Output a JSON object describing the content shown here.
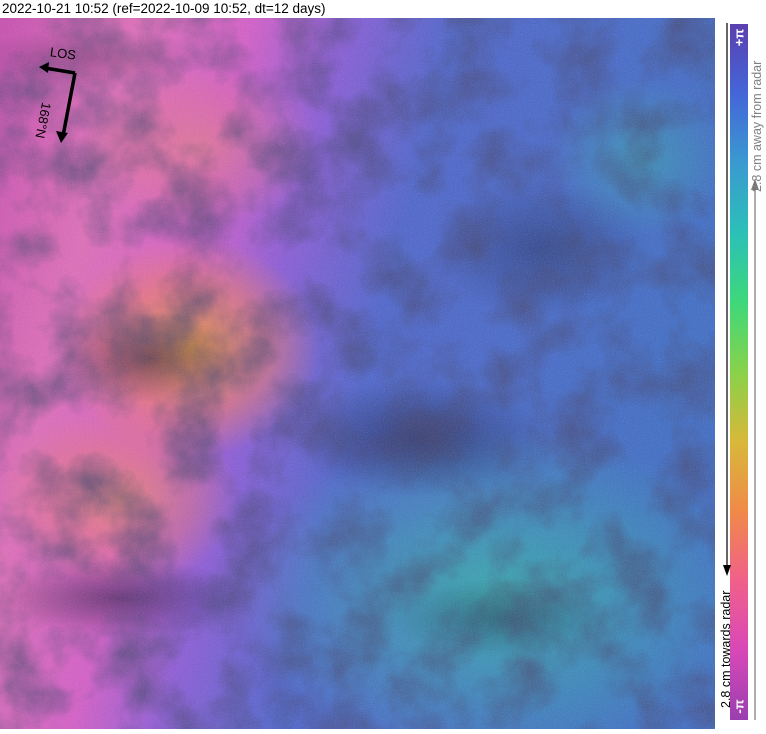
{
  "title": "2022-10-21 10:52 (ref=2022-10-09 10:52, dt=12 days)",
  "compass": {
    "los_label": "LOS",
    "heading_label": "168°N"
  },
  "colorbar": {
    "top_label": "+π",
    "bottom_label": "-π",
    "away_label": "2.8 cm away from radar",
    "towards_label": "2.8 cm towards radar",
    "colors": [
      "#5b3fb0",
      "#4466d8",
      "#3a9ad0",
      "#2bc0b8",
      "#3ed87a",
      "#88d24a",
      "#d8b83a",
      "#f08a48",
      "#f0608a",
      "#d848b8",
      "#9a3fb0"
    ]
  },
  "map": {
    "left_region_color": "#d85ac0",
    "center_band_color": "#f09050",
    "right_region_color": "#4a5fc8",
    "lower_right_color": "#2f9cb0"
  }
}
